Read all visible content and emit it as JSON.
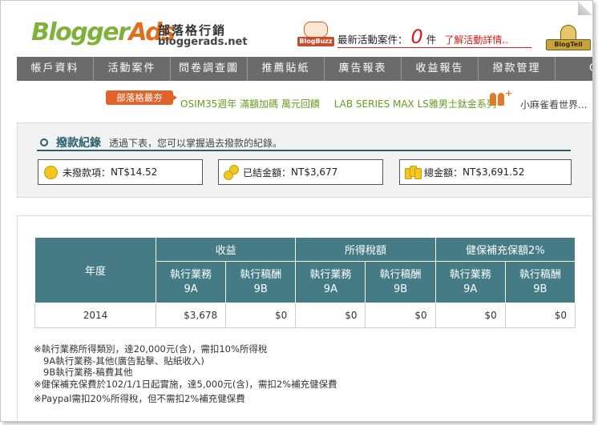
{
  "header": {
    "logo_part1": "Blogger",
    "logo_part2": "Ads",
    "brand_cn": "部落格行銷",
    "brand_url": "bloggerads.net",
    "blogbuzz_label": "BlogBuzz",
    "latest_label": "最新活動案件：",
    "latest_count": "0",
    "latest_unit": "件",
    "latest_link": "了解活動詳情..",
    "blogtell_label": "BlogTell"
  },
  "nav": {
    "items": [
      {
        "label": "帳戶資料"
      },
      {
        "label": "活動案件"
      },
      {
        "label": "問卷調查圖"
      },
      {
        "label": "推薦貼紙"
      },
      {
        "label": "廣告報表"
      },
      {
        "label": "收益報告"
      },
      {
        "label": "撥款管理"
      },
      {
        "label": "C"
      }
    ]
  },
  "news": {
    "badge": "部落格最夯",
    "items": [
      "OSIM35週年 滿額加碼 萬元回饋",
      "LAB SERIES MAX LS雅男士鈦金系列"
    ],
    "more": "小麻雀看世界..."
  },
  "record": {
    "title": "撥款紀錄",
    "subtitle": "透過下表，您可以掌握過去撥款的紀錄。",
    "unpaid_label": "未撥款項：",
    "unpaid_value": "NT$14.52",
    "settled_label": "已結金額：",
    "settled_value": "NT$3,677",
    "total_label": "總金額：",
    "total_value": "NT$3,691.52"
  },
  "table": {
    "year_header": "年度",
    "group_income": "收益",
    "group_tax": "所得稅額",
    "group_health": "健保補充保額2%",
    "sub_exec": "執行業務",
    "sub_exec_code": "9A",
    "sub_fee": "執行稿酬",
    "sub_fee_code": "9B",
    "rows": [
      {
        "year": "2014",
        "income_9a": "$3,678",
        "income_9b": "$0",
        "tax_9a": "$0",
        "tax_9b": "$0",
        "health_9a": "$0",
        "health_9b": "$0"
      }
    ]
  },
  "notes": {
    "line1": "※執行業務所得類別，達20,000元(含)，需扣10%所得稅",
    "line2": "9A執行業務-其他(廣告點擊、貼紙收入)",
    "line3": "9B執行業務-稿費其他",
    "line4": "※健保補充保費於102/1/1日起實施，達5,000元(含)，需扣2%補充健保費",
    "line5": "※Paypal需扣20%所得稅，但不需扣2%補充健保費"
  }
}
